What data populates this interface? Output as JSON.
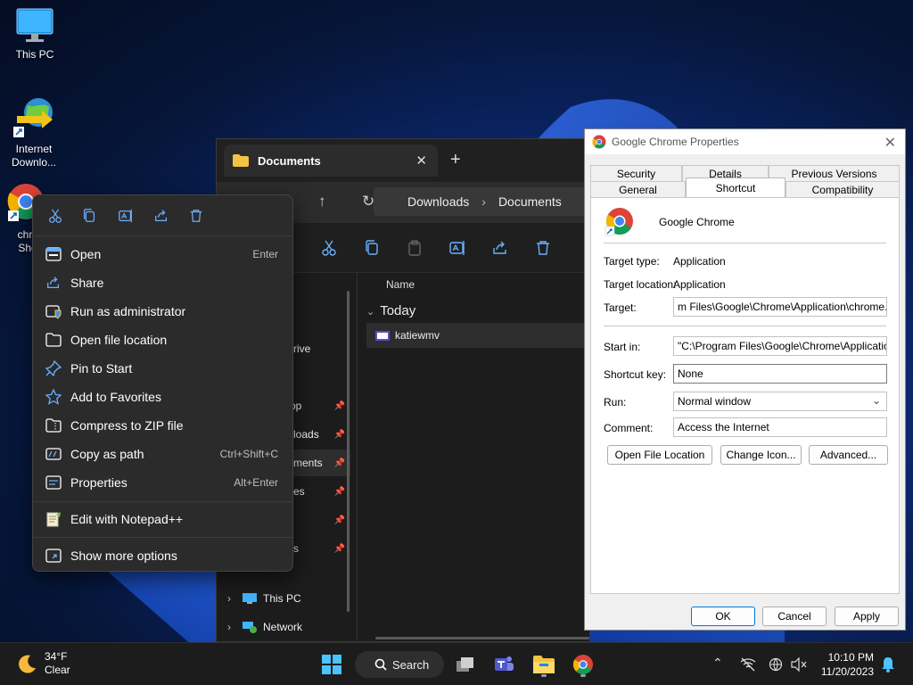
{
  "desktop": {
    "icons": [
      {
        "label": "This PC",
        "icon": "monitor-icon"
      },
      {
        "label_line1": "Internet",
        "label_line2": "Downlo...",
        "icon": "idm-globe-icon"
      },
      {
        "label_line1": "chrc",
        "label_line2": "Sho",
        "icon": "chrome-shortcut-icon"
      }
    ]
  },
  "explorer": {
    "tab_title": "Documents",
    "tab_close": "✕",
    "new_tab": "+",
    "breadcrumb": [
      "Downloads",
      "Documents"
    ],
    "nav_items": [
      {
        "label": "e",
        "pinned": false
      },
      {
        "label": "y",
        "pinned": false
      },
      {
        "label": "rive",
        "pinned": false
      },
      {
        "label": "op",
        "pinned": true
      },
      {
        "label": "loads",
        "pinned": true
      },
      {
        "label": "ments",
        "pinned": true
      },
      {
        "label": "es",
        "pinned": true
      },
      {
        "label": "",
        "pinned": true
      },
      {
        "label": "s",
        "pinned": true
      }
    ],
    "tree": [
      {
        "label": "This PC",
        "icon": "pc-icon"
      },
      {
        "label": "Network",
        "icon": "network-icon"
      }
    ],
    "column_header": "Name",
    "group": "Today",
    "file": "katiewmv"
  },
  "context_menu": {
    "quick_actions": [
      "cut-icon",
      "copy-icon",
      "rename-icon",
      "share-icon",
      "delete-icon"
    ],
    "items": [
      {
        "label": "Open",
        "shortcut": "Enter",
        "icon": "open-icon"
      },
      {
        "label": "Share",
        "shortcut": "",
        "icon": "share-icon"
      },
      {
        "label": "Run as administrator",
        "shortcut": "",
        "icon": "shield-icon"
      },
      {
        "label": "Open file location",
        "shortcut": "",
        "icon": "folder-icon"
      },
      {
        "label": "Pin to Start",
        "shortcut": "",
        "icon": "pin-icon"
      },
      {
        "label": "Add to Favorites",
        "shortcut": "",
        "icon": "star-icon"
      },
      {
        "label": "Compress to ZIP file",
        "shortcut": "",
        "icon": "zip-icon"
      },
      {
        "label": "Copy as path",
        "shortcut": "Ctrl+Shift+C",
        "icon": "copy-path-icon"
      },
      {
        "label": "Properties",
        "shortcut": "Alt+Enter",
        "icon": "properties-icon"
      }
    ],
    "notepad": {
      "label": "Edit with Notepad++",
      "icon": "notepad-icon"
    },
    "more": {
      "label": "Show more options",
      "icon": "more-options-icon"
    }
  },
  "properties": {
    "title": "Google Chrome Properties",
    "close": "✕",
    "tabs_top": [
      "Security",
      "Details",
      "Previous Versions"
    ],
    "tabs_bottom": [
      "General",
      "Shortcut",
      "Compatibility"
    ],
    "active_tab": "Shortcut",
    "app_name": "Google Chrome",
    "target_type_label": "Target type:",
    "target_type": "Application",
    "target_location_label": "Target location:",
    "target_location": "Application",
    "target_label": "Target:",
    "target": "m Files\\Google\\Chrome\\Application\\chrome.exe\"",
    "start_in_label": "Start in:",
    "start_in": "\"C:\\Program Files\\Google\\Chrome\\Application\"",
    "shortcut_key_label": "Shortcut key:",
    "shortcut_key": "None",
    "run_label": "Run:",
    "run": "Normal window",
    "comment_label": "Comment:",
    "comment": "Access the Internet",
    "btn_open_location": "Open File Location",
    "btn_change_icon": "Change Icon...",
    "btn_advanced": "Advanced...",
    "btn_ok": "OK",
    "btn_cancel": "Cancel",
    "btn_apply": "Apply"
  },
  "taskbar": {
    "weather_temp": "34°F",
    "weather_desc": "Clear",
    "search": "Search",
    "time": "10:10 PM",
    "date": "11/20/2023"
  }
}
